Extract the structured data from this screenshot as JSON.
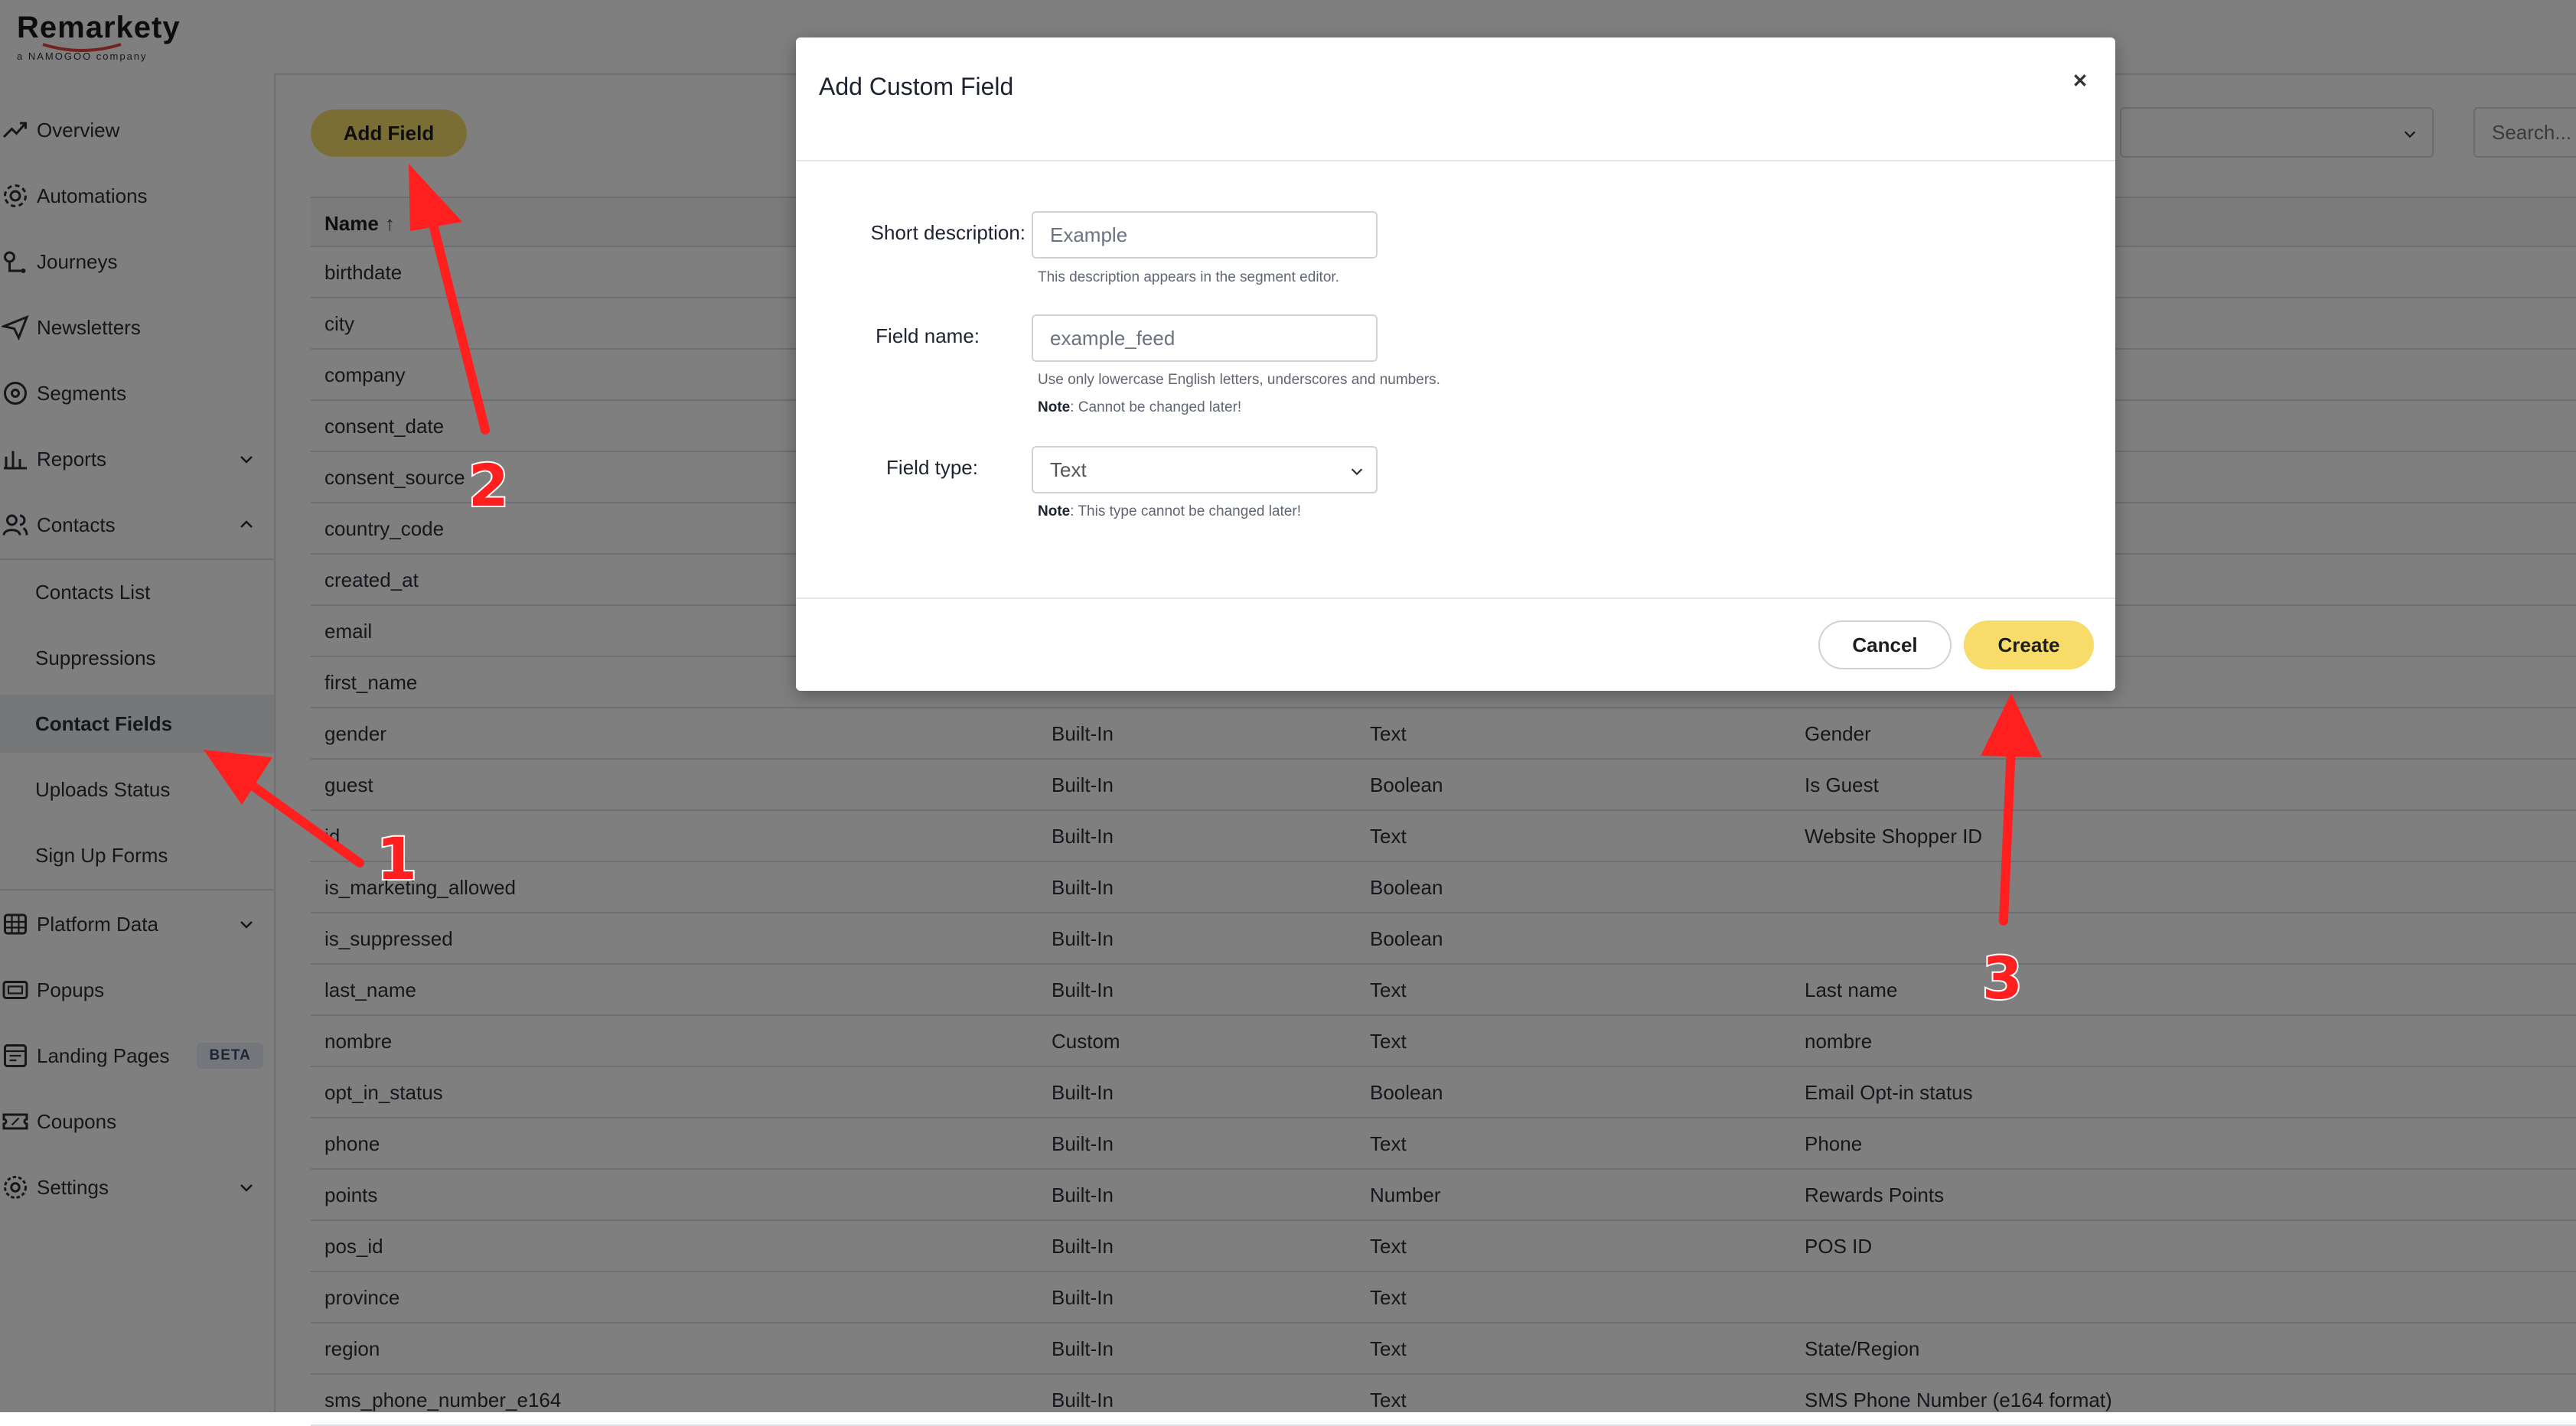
{
  "brand": {
    "name": "Remarkety",
    "tagline": "a NAMOGOO company"
  },
  "sidebar": {
    "items": [
      {
        "label": "Overview",
        "icon": "trend-line-icon"
      },
      {
        "label": "Automations",
        "icon": "gear-automation-icon"
      },
      {
        "label": "Journeys",
        "icon": "route-pin-icon"
      },
      {
        "label": "Newsletters",
        "icon": "paper-plane-icon"
      },
      {
        "label": "Segments",
        "icon": "segments-icon"
      },
      {
        "label": "Reports",
        "icon": "bar-chart-icon"
      },
      {
        "label": "Contacts",
        "icon": "users-icon"
      },
      {
        "label": "Contacts List"
      },
      {
        "label": "Suppressions"
      },
      {
        "label": "Contact Fields"
      },
      {
        "label": "Uploads Status"
      },
      {
        "label": "Sign Up Forms"
      },
      {
        "label": "Platform Data",
        "icon": "database-icon"
      },
      {
        "label": "Popups",
        "icon": "popup-window-icon"
      },
      {
        "label": "Landing Pages",
        "icon": "landing-page-icon",
        "badge": "BETA"
      },
      {
        "label": "Coupons",
        "icon": "coupon-icon"
      },
      {
        "label": "Settings",
        "icon": "settings-icon"
      }
    ]
  },
  "toolbar": {
    "add_field_label": "Add Field",
    "search_placeholder": "Search..."
  },
  "table": {
    "name_header": "Name",
    "sort_indicator": "↑",
    "rows": [
      {
        "name": "birthdate",
        "type": "",
        "data_type": "",
        "description": ""
      },
      {
        "name": "city",
        "type": "",
        "data_type": "",
        "description": ""
      },
      {
        "name": "company",
        "type": "",
        "data_type": "",
        "description": ""
      },
      {
        "name": "consent_date",
        "type": "",
        "data_type": "",
        "description": ""
      },
      {
        "name": "consent_source",
        "type": "",
        "data_type": "",
        "description": ""
      },
      {
        "name": "country_code",
        "type": "",
        "data_type": "",
        "description": ""
      },
      {
        "name": "created_at",
        "type": "",
        "data_type": "",
        "description": ""
      },
      {
        "name": "email",
        "type": "",
        "data_type": "",
        "description": ""
      },
      {
        "name": "first_name",
        "type": "",
        "data_type": "",
        "description": ""
      },
      {
        "name": "gender",
        "type": "Built-In",
        "data_type": "Text",
        "description": "Gender"
      },
      {
        "name": "guest",
        "type": "Built-In",
        "data_type": "Boolean",
        "description": "Is Guest"
      },
      {
        "name": "id",
        "type": "Built-In",
        "data_type": "Text",
        "description": "Website Shopper ID"
      },
      {
        "name": "is_marketing_allowed",
        "type": "Built-In",
        "data_type": "Boolean",
        "description": ""
      },
      {
        "name": "is_suppressed",
        "type": "Built-In",
        "data_type": "Boolean",
        "description": ""
      },
      {
        "name": "last_name",
        "type": "Built-In",
        "data_type": "Text",
        "description": "Last name"
      },
      {
        "name": "nombre",
        "type": "Custom",
        "data_type": "Text",
        "description": "nombre"
      },
      {
        "name": "opt_in_status",
        "type": "Built-In",
        "data_type": "Boolean",
        "description": "Email Opt-in status"
      },
      {
        "name": "phone",
        "type": "Built-In",
        "data_type": "Text",
        "description": "Phone"
      },
      {
        "name": "points",
        "type": "Built-In",
        "data_type": "Number",
        "description": "Rewards Points"
      },
      {
        "name": "pos_id",
        "type": "Built-In",
        "data_type": "Text",
        "description": "POS ID"
      },
      {
        "name": "province",
        "type": "Built-In",
        "data_type": "Text",
        "description": ""
      },
      {
        "name": "region",
        "type": "Built-In",
        "data_type": "Text",
        "description": "State/Region"
      },
      {
        "name": "sms_phone_number_e164",
        "type": "Built-In",
        "data_type": "Text",
        "description": "SMS Phone Number (e164 format)"
      }
    ]
  },
  "modal": {
    "title": "Add Custom Field",
    "close_icon": "close-icon",
    "short_description_label": "Short description:",
    "short_description_placeholder": "Example",
    "short_description_hint": "This description appears in the segment editor.",
    "field_name_label": "Field name:",
    "field_name_placeholder": "example_feed",
    "field_name_hint": "Use only lowercase English letters, underscores and numbers.",
    "field_name_note_label": "Note",
    "field_name_note": ": Cannot be changed later!",
    "field_type_label": "Field type:",
    "field_type_value": "Text",
    "field_type_note_label": "Note",
    "field_type_note": ": This type cannot be changed later!",
    "cancel_label": "Cancel",
    "create_label": "Create"
  },
  "annotations": {
    "step_1": "1",
    "step_2": "2",
    "step_3": "3"
  },
  "colors": {
    "accent": "#f7dc6a",
    "annotation": "#ff1f1f",
    "overlay": "rgba(0,0,0,0.5)"
  }
}
